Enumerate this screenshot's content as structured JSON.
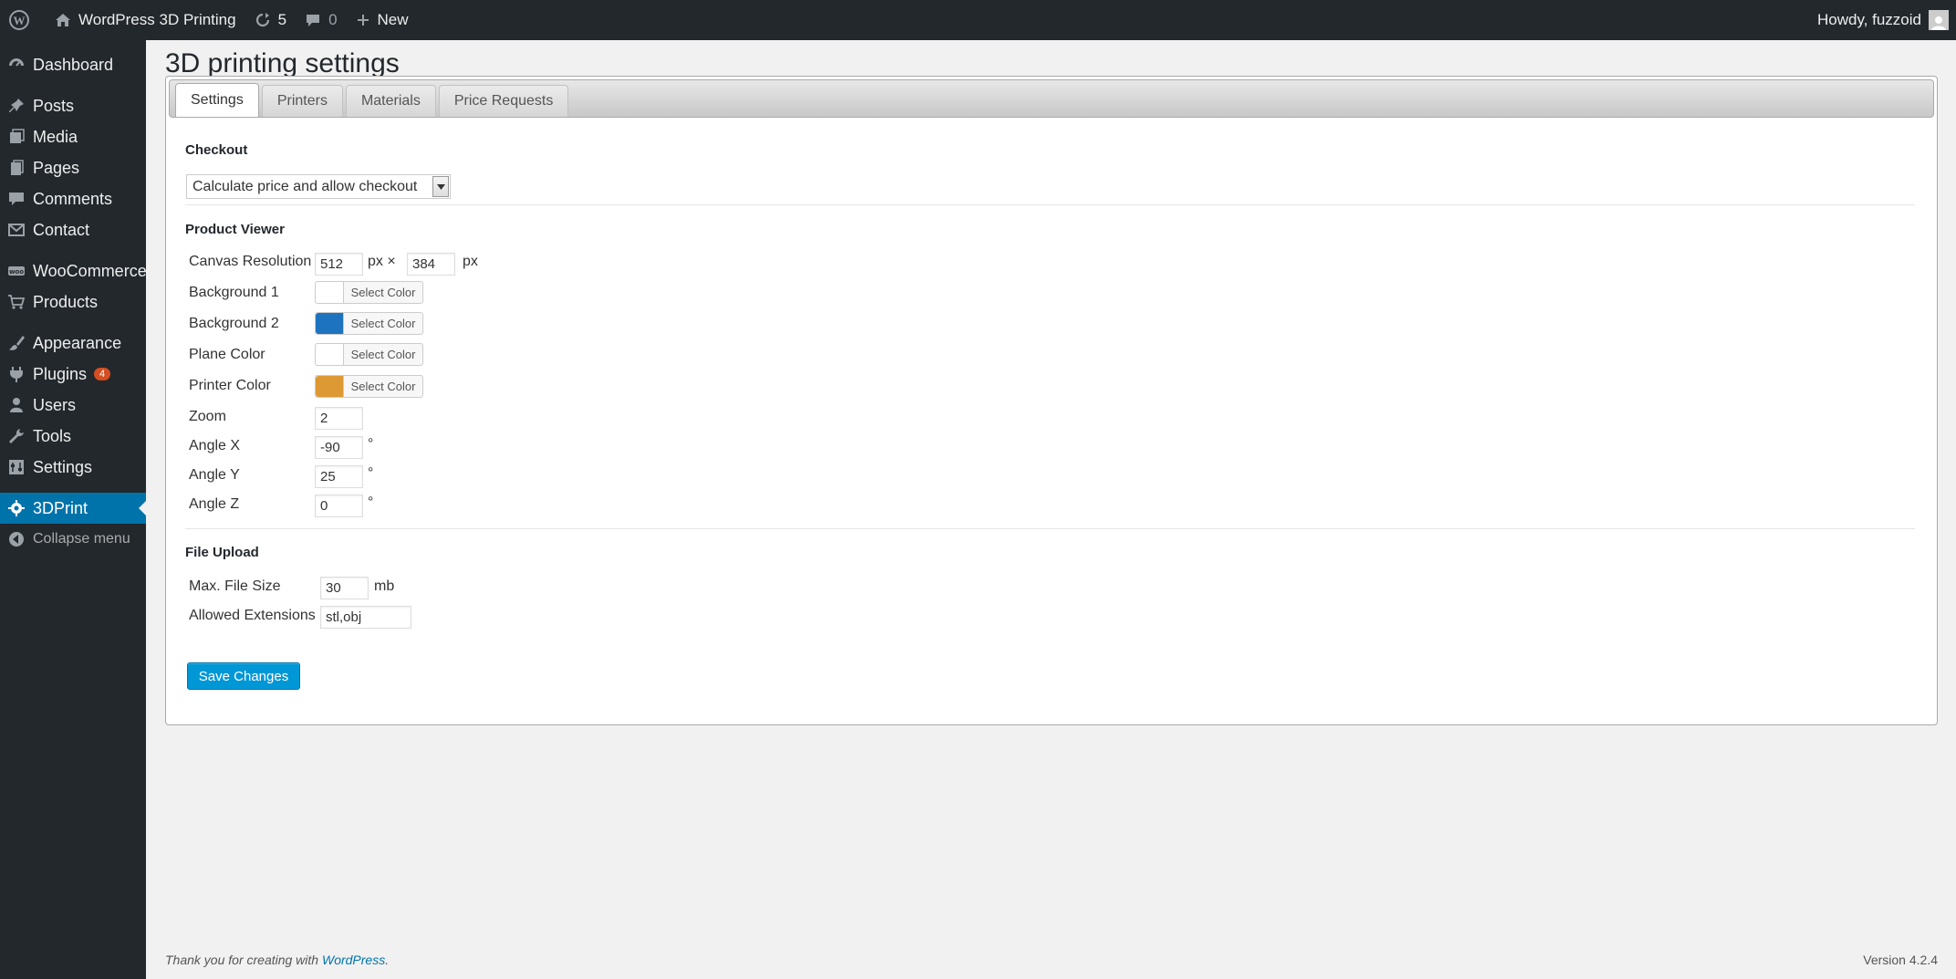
{
  "adminbar": {
    "site_name": "WordPress 3D Printing",
    "updates_count": "5",
    "comments_count": "0",
    "new_label": "New",
    "howdy": "Howdy, fuzzoid"
  },
  "sidebar": {
    "items": [
      {
        "label": "Dashboard",
        "icon": "dashboard-icon"
      },
      {
        "label": "Posts",
        "icon": "pin-icon"
      },
      {
        "label": "Media",
        "icon": "media-icon"
      },
      {
        "label": "Pages",
        "icon": "pages-icon"
      },
      {
        "label": "Comments",
        "icon": "comment-icon"
      },
      {
        "label": "Contact",
        "icon": "mail-icon"
      },
      {
        "label": "WooCommerce",
        "icon": "woocommerce-icon"
      },
      {
        "label": "Products",
        "icon": "cart-icon"
      },
      {
        "label": "Appearance",
        "icon": "brush-icon"
      },
      {
        "label": "Plugins",
        "icon": "plug-icon",
        "badge": "4"
      },
      {
        "label": "Users",
        "icon": "user-icon"
      },
      {
        "label": "Tools",
        "icon": "wrench-icon"
      },
      {
        "label": "Settings",
        "icon": "settings-icon"
      },
      {
        "label": "3DPrint",
        "icon": "gear-icon",
        "current": true
      }
    ],
    "collapse_label": "Collapse menu"
  },
  "page": {
    "title": "3D printing settings",
    "tabs": [
      "Settings",
      "Printers",
      "Materials",
      "Price Requests"
    ],
    "active_tab": "Settings"
  },
  "checkout": {
    "section_title": "Checkout",
    "selected": "Calculate price and allow checkout"
  },
  "viewer": {
    "section_title": "Product Viewer",
    "canvas_label": "Canvas Resolution",
    "canvas_width": "512",
    "canvas_height": "384",
    "px_x": "px ×",
    "px": "px",
    "select_color_label": "Select Color",
    "colors": [
      {
        "label": "Background 1",
        "color": "#ffffff"
      },
      {
        "label": "Background 2",
        "color": "#1e73be"
      },
      {
        "label": "Plane Color",
        "color": "#ffffff"
      },
      {
        "label": "Printer Color",
        "color": "#dd9933"
      }
    ],
    "zoom_label": "Zoom",
    "zoom": "2",
    "angle_x_label": "Angle X",
    "angle_x": "-90",
    "angle_y_label": "Angle Y",
    "angle_y": "25",
    "angle_z_label": "Angle Z",
    "angle_z": "0",
    "degree": "°"
  },
  "upload": {
    "section_title": "File Upload",
    "max_size_label": "Max. File Size",
    "max_size": "30",
    "mb": "mb",
    "extensions_label": "Allowed Extensions",
    "extensions": "stl,obj"
  },
  "save_label": "Save Changes",
  "footer": {
    "thanks_prefix": "Thank you for creating with",
    "wordpress_link": "WordPress",
    "thanks_suffix": ".",
    "version": "Version 4.2.4"
  }
}
